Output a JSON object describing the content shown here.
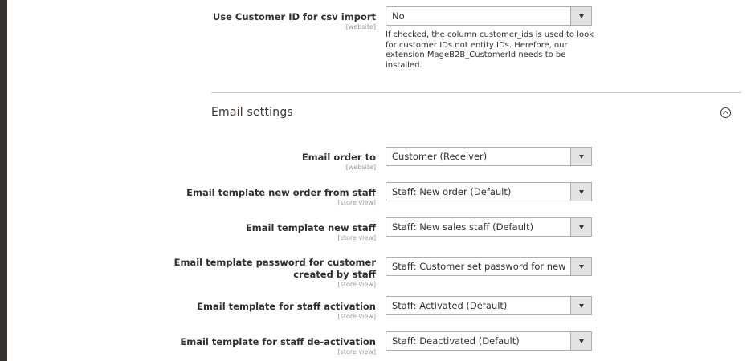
{
  "top_field": {
    "label": "Use Customer ID for csv import",
    "scope": "[website]",
    "value": "No",
    "note": "If checked, the column customer_ids is used to look for customer IDs not entity IDs. Herefore, our extension MageB2B_CustomerId needs to be installed."
  },
  "section": {
    "title": "Email settings",
    "collapse_icon": "chevron-up-circle-icon"
  },
  "fields": [
    {
      "label": "Email order to",
      "scope": "[website]",
      "value": "Customer (Receiver)"
    },
    {
      "label": "Email template new order from staff",
      "scope": "[store view]",
      "value": "Staff: New order (Default)"
    },
    {
      "label": "Email template new staff",
      "scope": "[store view]",
      "value": "Staff: New sales staff (Default)"
    },
    {
      "label_line1": "Email template password for customer",
      "label_line2": "created by staff",
      "scope": "[store view]",
      "value": "Staff: Customer set password for new account (Default)"
    },
    {
      "label": "Email template for staff activation",
      "scope": "[store view]",
      "value": "Staff: Activated (Default)"
    },
    {
      "label": "Email template for staff de-activation",
      "scope": "[store view]",
      "value": "Staff: Deactivated (Default)"
    }
  ],
  "colors": {
    "sidebar": "#373330",
    "text": "#303030",
    "border": "#adadad",
    "select_button": "#e3e3e3"
  }
}
